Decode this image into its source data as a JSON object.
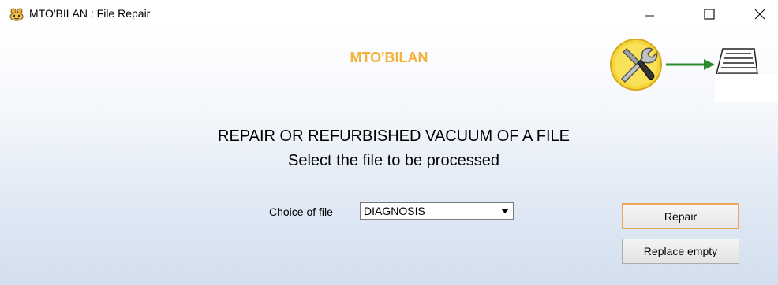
{
  "window": {
    "title": "MTO'BILAN : File Repair",
    "min_icon": "minimize-icon",
    "max_icon": "maximize-icon",
    "close_icon": "close-icon"
  },
  "header": {
    "brand": "MTO'BILAN",
    "graphic_icons": [
      "tools-icon",
      "arrow-right-icon",
      "file-tray-icon"
    ],
    "colors": {
      "brand": "#f4b23c",
      "arrow": "#2e8b2e",
      "tools_circle": "#f6d63a"
    }
  },
  "main": {
    "heading_line1": "REPAIR OR REFURBISHED VACUUM OF A FILE",
    "heading_line2": "Select the file to be processed",
    "choice_label": "Choice of file",
    "file_select": {
      "selected": "DIAGNOSIS"
    }
  },
  "actions": {
    "repair_label": "Repair",
    "replace_empty_label": "Replace empty"
  }
}
